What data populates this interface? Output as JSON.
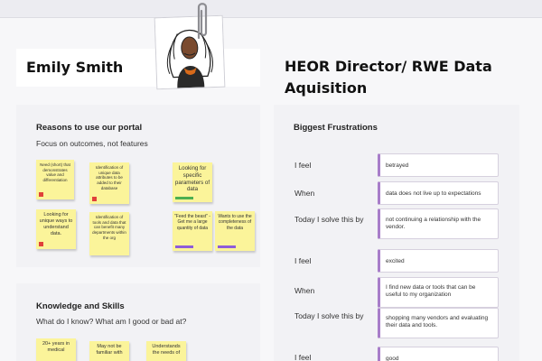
{
  "profile": {
    "name": "Emily Smith",
    "role": "HEOR Director/ RWE Data Aquisition"
  },
  "reasons": {
    "title": "Reasons to use our portal",
    "subtitle": "Focus on outcomes, not features",
    "notes": [
      "Need (short) that demonstrates value and differentiation",
      "Identification of unique data attributes to be added to their database",
      "Looking for specific parameters of data",
      "Looking for unique ways to understand data.",
      "Identification of tools and data that can benefit many departments within the org",
      "\"Feed the beast\" - Get me a large quantity of data",
      "Wants to use the completeness of the data"
    ]
  },
  "knowledge": {
    "title": "Knowledge and Skills",
    "subtitle": "What do I know? What am I good or bad at?",
    "notes": [
      "20+ years in medical",
      "May not be familiar with",
      "Understands the needs of"
    ]
  },
  "frustrations": {
    "title": "Biggest Frustrations",
    "groups": [
      {
        "feel_label": "I feel",
        "feel": "betrayed",
        "when_label": "When",
        "when": "data does not live up to expectations",
        "solve_label": "Today I solve this by",
        "solve": "not continuing a relationship with the vendor."
      },
      {
        "feel_label": "I feel",
        "feel": "excited",
        "when_label": "When",
        "when": "I find new data or tools that can be useful to my organization",
        "solve_label": "Today I solve this by",
        "solve": "shopping many vendors and evaluating their data and tools."
      },
      {
        "feel_label": "I feel",
        "feel": "good"
      }
    ]
  },
  "colors": {
    "sticky": "#fbf49a",
    "accent": "#a87dc9",
    "tag_red": "#e0413a",
    "tag_green": "#4caf50",
    "tag_purple": "#8e5cd9"
  }
}
